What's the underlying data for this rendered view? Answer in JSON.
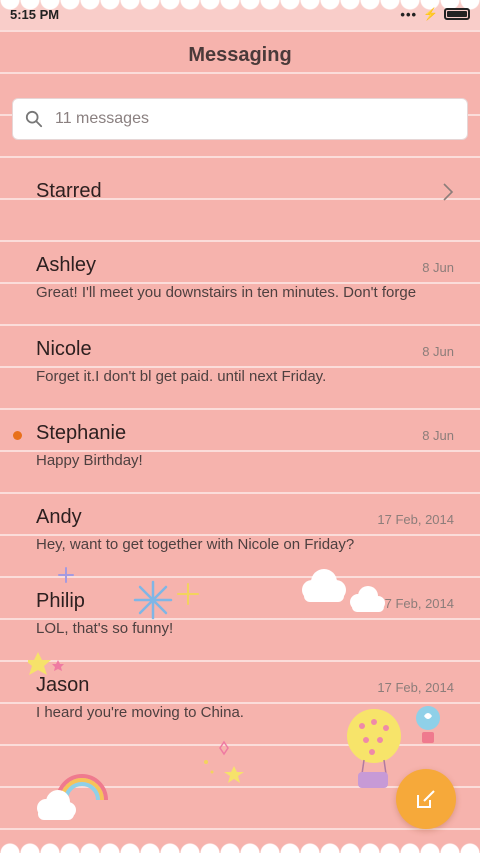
{
  "status_bar": {
    "time": "5:15 PM",
    "icons": [
      "more-dots-icon",
      "charging-bolt-icon",
      "battery-icon"
    ]
  },
  "header": {
    "title": "Messaging"
  },
  "search": {
    "placeholder": "11 messages",
    "icon": "search-icon"
  },
  "starred": {
    "label": "Starred",
    "icon": "chevron-right-icon"
  },
  "conversations": [
    {
      "name": "Ashley",
      "date": "8 Jun",
      "preview": "Great! I'll meet you downstairs in ten minutes. Don't forge",
      "unread": false
    },
    {
      "name": "Nicole",
      "date": "8 Jun",
      "preview": "Forget it.I don't bl get paid. until next Friday.",
      "unread": false
    },
    {
      "name": "Stephanie",
      "date": "8 Jun",
      "preview": "Happy Birthday!",
      "unread": true
    },
    {
      "name": "Andy",
      "date": "17 Feb, 2014",
      "preview": "Hey, want to get together with Nicole on Friday?",
      "unread": false
    },
    {
      "name": "Philip",
      "date": "17 Feb, 2014",
      "preview": "LOL, that's so funny!",
      "unread": false
    },
    {
      "name": "Jason",
      "date": "17 Feb, 2014",
      "preview": "I heard you're moving to China.",
      "unread": false
    }
  ],
  "fab": {
    "icon": "compose-icon"
  },
  "colors": {
    "background": "#f6b3ad",
    "accent": "#f6a93a",
    "unread_dot": "#e8701c"
  }
}
